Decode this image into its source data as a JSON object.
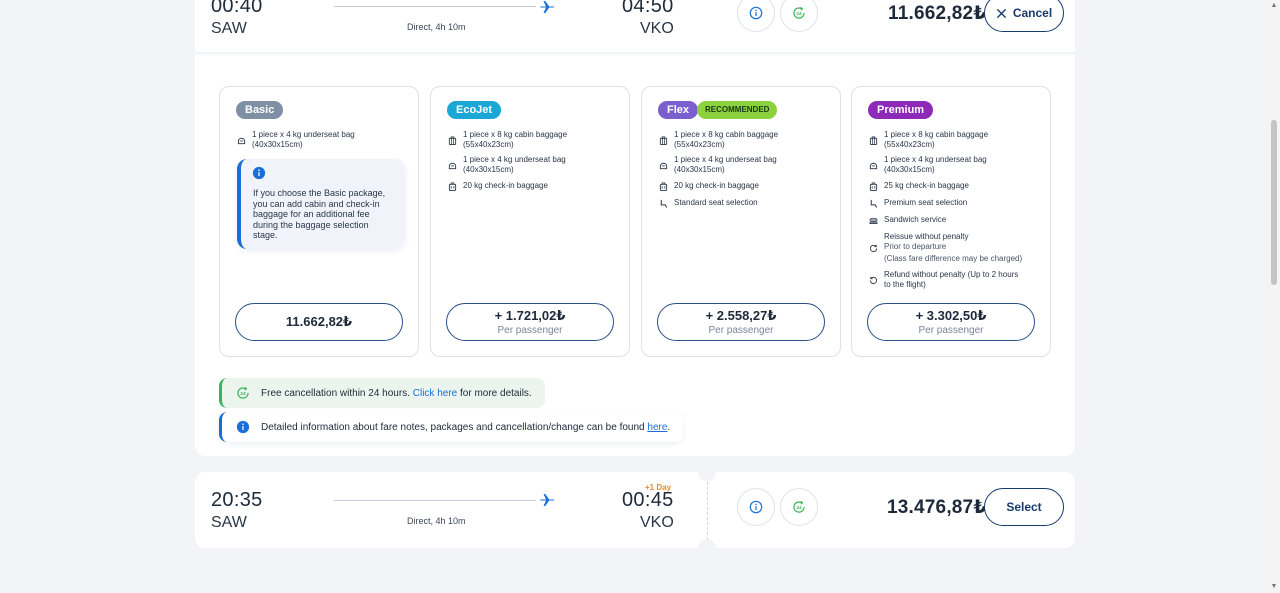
{
  "flights": [
    {
      "dep_time": "00:40",
      "dep_code": "SAW",
      "arr_time": "04:50",
      "arr_code": "VKO",
      "duration": "Direct, 4h 10m",
      "price": "11.662,82₺",
      "action_label": "Cancel"
    },
    {
      "dep_time": "20:35",
      "dep_code": "SAW",
      "arr_time": "00:45",
      "arr_code": "VKO",
      "plus_day": "+1 Day",
      "duration": "Direct, 4h 10m",
      "price": "13.476,87₺",
      "action_label": "Select"
    }
  ],
  "packages": {
    "basic": {
      "tag": "Basic",
      "color": "#7f8fa4",
      "features": [
        {
          "icon": "underseat-bag-icon",
          "line1": "1 piece x 4 kg underseat bag",
          "line2": "(40x30x15cm)"
        }
      ],
      "info": "If you choose the Basic package, you can add cabin and check-in baggage for an additional fee during the baggage selection stage.",
      "price": "11.662,82₺"
    },
    "ecojet": {
      "tag": "EcoJet",
      "color": "#1aa7d6",
      "features": [
        {
          "icon": "cabin-bag-icon",
          "line1": "1 piece x 8 kg cabin baggage",
          "line2": "(55x40x23cm)"
        },
        {
          "icon": "underseat-bag-icon",
          "line1": "1 piece x 4 kg underseat bag",
          "line2": "(40x30x15cm)"
        },
        {
          "icon": "checkin-bag-icon",
          "line1": "20 kg check-in baggage"
        }
      ],
      "price": "+ 1.721,02₺",
      "per": "Per passenger"
    },
    "flex": {
      "tag": "Flex",
      "recommended": "RECOMMENDED",
      "color": "#7b5fcf",
      "features": [
        {
          "icon": "cabin-bag-icon",
          "line1": "1 piece x 8 kg cabin baggage",
          "line2": "(55x40x23cm)"
        },
        {
          "icon": "underseat-bag-icon",
          "line1": "1 piece x 4 kg underseat bag",
          "line2": "(40x30x15cm)"
        },
        {
          "icon": "checkin-bag-icon",
          "line1": "20 kg check-in baggage"
        },
        {
          "icon": "seat-icon",
          "line1": "Standard seat selection"
        }
      ],
      "price": "+ 2.558,27₺",
      "per": "Per passenger"
    },
    "premium": {
      "tag": "Premium",
      "color": "#8b2bb8",
      "features": [
        {
          "icon": "cabin-bag-icon",
          "line1": "1 piece x 8 kg cabin baggage",
          "line2": "(55x40x23cm)"
        },
        {
          "icon": "underseat-bag-icon",
          "line1": "1 piece x 4 kg underseat bag",
          "line2": "(40x30x15cm)"
        },
        {
          "icon": "checkin-bag-icon",
          "line1": "25 kg check-in baggage"
        },
        {
          "icon": "seat-icon",
          "line1": "Premium seat selection"
        },
        {
          "icon": "sandwich-icon",
          "line1": "Sandwich service"
        },
        {
          "icon": "reissue-icon",
          "line1": "Reissue without penalty",
          "line2": "Prior to departure",
          "line3": "(Class fare difference may be charged)"
        },
        {
          "icon": "refund-icon",
          "line1": "Refund without penalty (Up to 2 hours",
          "line2": "to the flight)"
        }
      ],
      "price": "+ 3.302,50₺",
      "per": "Per passenger"
    }
  },
  "notices": {
    "cancellation": {
      "text_before": "Free cancellation within 24 hours.",
      "link": "Click here",
      "text_after": "for more details."
    },
    "fare_info": {
      "text_before": "Detailed information about fare notes, packages and cancellation/change can be found",
      "link": "here",
      "text_after": "."
    }
  },
  "colors": {
    "accent": "#1a6fd6",
    "navy": "#1a3a6c",
    "green": "#3cb35a"
  }
}
